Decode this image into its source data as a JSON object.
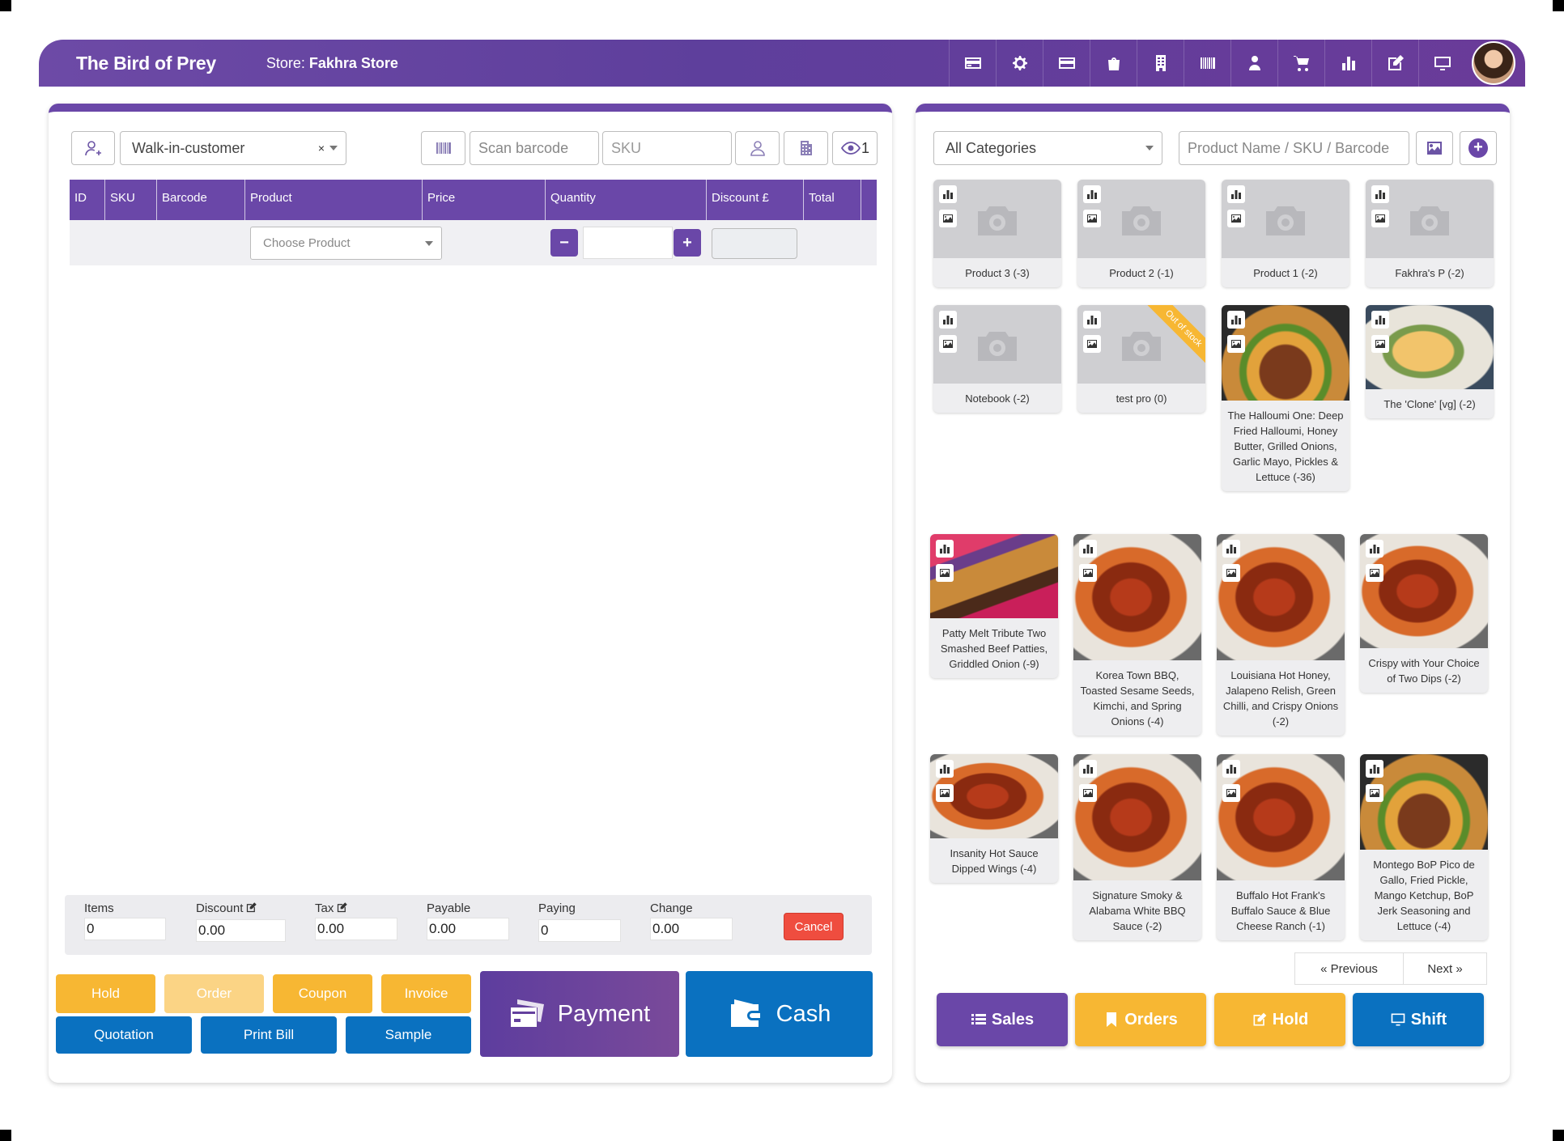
{
  "app": {
    "title": "The Bird of Prey",
    "store_label": "Store:",
    "store_name": "Fakhra Store"
  },
  "topbar_icons": [
    "credit-card-icon",
    "settings-icon",
    "card-icon",
    "shopping-bag-icon",
    "building-icon",
    "barcode-icon",
    "user-icon",
    "cart-icon",
    "bar-chart-icon",
    "edit-icon",
    "monitor-icon"
  ],
  "customer": {
    "selected": "Walk-in-customer",
    "clear": "×"
  },
  "scan": {
    "placeholder": "Scan barcode",
    "sku_placeholder": "SKU",
    "view_count": "1"
  },
  "table": {
    "headers": [
      "ID",
      "SKU",
      "Barcode",
      "Product",
      "Price",
      "Quantity",
      "Discount £",
      "Total"
    ],
    "choose_product": "Choose Product",
    "minus": "−",
    "plus": "+"
  },
  "totals": {
    "items": {
      "label": "Items",
      "value": "0"
    },
    "discount": {
      "label": "Discount",
      "value": "0.00"
    },
    "tax": {
      "label": "Tax",
      "value": "0.00"
    },
    "payable": {
      "label": "Payable",
      "value": "0.00"
    },
    "paying": {
      "label": "Paying",
      "value": "0"
    },
    "change": {
      "label": "Change",
      "value": "0.00"
    },
    "cancel": "Cancel"
  },
  "actions": {
    "hold": "Hold",
    "order": "Order",
    "coupon": "Coupon",
    "invoice": "Invoice",
    "quotation": "Quotation",
    "print_bill": "Print Bill",
    "sample": "Sample",
    "payment": "Payment",
    "cash": "Cash"
  },
  "catalog": {
    "category": "All Categories",
    "search_placeholder": "Product Name / SKU / Barcode",
    "products": [
      {
        "name": "Product 3 (-3)",
        "image": "placeholder"
      },
      {
        "name": "Product 2 (-1)",
        "image": "placeholder"
      },
      {
        "name": "Product 1 (-2)",
        "image": "placeholder"
      },
      {
        "name": "Fakhra's P (-2)",
        "image": "placeholder"
      },
      {
        "name": "Notebook (-2)",
        "image": "placeholder"
      },
      {
        "name": "test pro (0)",
        "image": "placeholder",
        "ribbon": "Out of stock"
      },
      {
        "name": "The Halloumi One: Deep Fried Halloumi, Honey Butter, Grilled Onions, Garlic Mayo, Pickles & Lettuce (-36)",
        "image": "burger"
      },
      {
        "name": "The 'Clone' [vg] (-2)",
        "image": "wrap"
      },
      {
        "name": "Patty Melt Tribute Two Smashed Beef Patties, Griddled Onion (-9)",
        "image": "sandwich"
      },
      {
        "name": "Korea Town BBQ, Toasted Sesame Seeds, Kimchi, and Spring Onions (-4)",
        "image": "wings"
      },
      {
        "name": "Louisiana Hot Honey, Jalapeno Relish, Green Chilli, and Crispy Onions (-2)",
        "image": "wings"
      },
      {
        "name": "Crispy with Your Choice of Two Dips (-2)",
        "image": "wings"
      },
      {
        "name": "Insanity Hot Sauce Dipped Wings (-4)",
        "image": "wings"
      },
      {
        "name": "Signature Smoky & Alabama White BBQ Sauce (-2)",
        "image": "wings"
      },
      {
        "name": "Buffalo Hot Frank's Buffalo Sauce & Blue Cheese Ranch (-1)",
        "image": "wings"
      },
      {
        "name": "Montego BoP Pico de Gallo, Fried Pickle, Mango Ketchup, BoP Jerk Seasoning and Lettuce (-4)",
        "image": "burger"
      }
    ],
    "prev": "« Previous",
    "next": "Next »"
  },
  "bottom_nav": {
    "sales": "Sales",
    "orders": "Orders",
    "hold": "Hold",
    "shift": "Shift"
  },
  "colors": {
    "purple": "#6a47a8",
    "yellow": "#f7b733",
    "blue": "#0a71c0",
    "red": "#ef4d3f"
  }
}
